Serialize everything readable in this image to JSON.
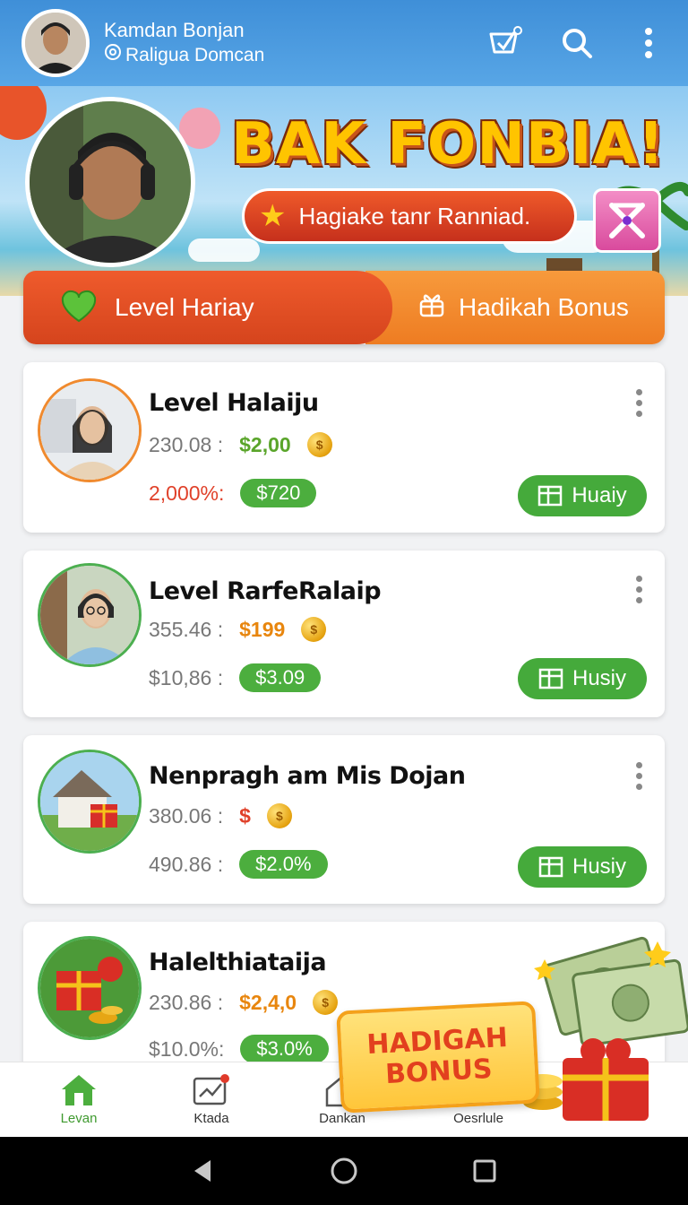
{
  "header": {
    "user_name": "Kamdan Bonjan",
    "user_handle": "Raligua Domcan",
    "icons": [
      "cart-check-icon",
      "search-icon",
      "more-vert-icon"
    ]
  },
  "hero": {
    "headline": "BAK FONBIA!",
    "pill_text": "Hagiake tanr Ranniad."
  },
  "tabs": [
    {
      "label": "Level Hariay",
      "icon": "heart-icon",
      "active": true
    },
    {
      "label": "Hadikah Bonus",
      "icon": "gift-icon",
      "active": false
    }
  ],
  "cards": [
    {
      "title": "Level Halaiju",
      "row1_label": "230.08 :",
      "row1_price": "$2,00",
      "row2_label": "2,000%:",
      "row2_badge": "$720",
      "button": "Huaiy"
    },
    {
      "title": "Level RarfeRalaip",
      "row1_label": "355.46 :",
      "row1_price": "$199",
      "row2_label": "$10,86 :",
      "row2_badge": "$3.09",
      "button": "Husiy"
    },
    {
      "title": "Nenpragh am Mis Dojan",
      "row1_label": "380.06 :",
      "row1_price": "$",
      "row2_label": "490.86 :",
      "row2_badge": "$2.0%",
      "button": "Husiy"
    },
    {
      "title": "Halelthiataija",
      "row1_label": "230.86 :",
      "row1_price": "$2,4,0",
      "row2_label": "$10.0%:",
      "row2_badge": "$3.0%"
    }
  ],
  "promo": {
    "line1": "HADIGAH",
    "line2": "BONUS"
  },
  "bottom_nav": [
    {
      "label": "Levan",
      "icon": "home-icon",
      "active": true
    },
    {
      "label": "Ktada",
      "icon": "chart-icon",
      "active": false
    },
    {
      "label": "Dankan",
      "icon": "house-outline-icon",
      "active": false
    },
    {
      "label": "Oesrlule",
      "icon": "schedule-icon",
      "active": false
    }
  ],
  "colors": {
    "appbar": "#3f8fd8",
    "tab_active": "#e04e23",
    "tab_other": "#f28a2e",
    "accent_green": "#45aa3b"
  }
}
